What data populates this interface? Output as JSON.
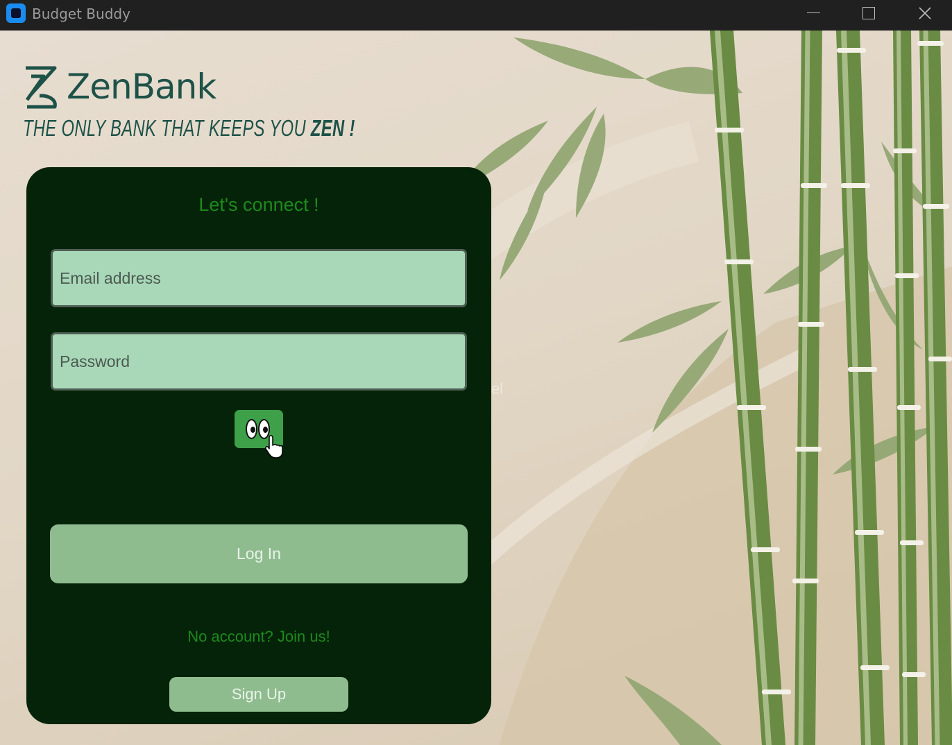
{
  "window": {
    "title": "Budget Buddy",
    "controls": [
      "minimize",
      "maximize",
      "close"
    ]
  },
  "brand": {
    "name": "ZenBank",
    "tagline_main": "THE ONLY BANK THAT KEEPS YOU ",
    "tagline_emph": "ZEN !",
    "color": "#1e5248"
  },
  "login": {
    "title": "Let's connect !",
    "email_placeholder": "Email address",
    "password_placeholder": "Password",
    "toggle_icon": "eyes-icon",
    "login_label": "Log In",
    "no_account_text": "No account? Join us!",
    "signup_label": "Sign Up"
  },
  "background": {
    "partial_text": "el"
  },
  "colors": {
    "card": "#052309",
    "accent_text": "#1d8a1d",
    "field": "#a9d8b8",
    "button": "#8fbc8f",
    "eye_button": "#3ea049"
  }
}
